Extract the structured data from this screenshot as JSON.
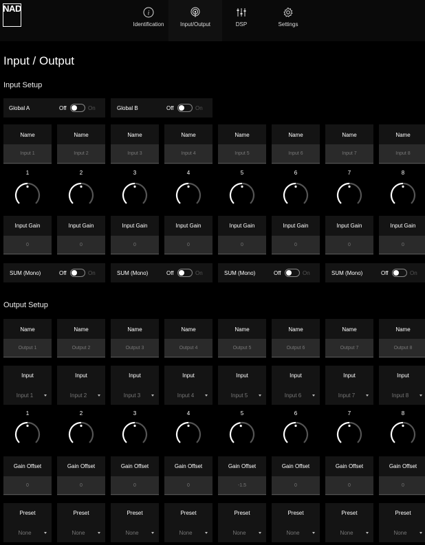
{
  "brand": {
    "logo_text": "NAD"
  },
  "nav": {
    "tabs": [
      {
        "label": "Identification",
        "icon": "info-icon",
        "active": false
      },
      {
        "label": "Input/Output",
        "icon": "broadcast-icon",
        "active": true
      },
      {
        "label": "DSP",
        "icon": "sliders-icon",
        "active": false
      },
      {
        "label": "Settings",
        "icon": "gear-icon",
        "active": false
      }
    ]
  },
  "page_title": "Input / Output",
  "input_setup": {
    "title": "Input Setup",
    "globals": [
      {
        "label": "Global A",
        "off": "Off",
        "on": "On",
        "state": "off"
      },
      {
        "label": "Global B",
        "off": "Off",
        "on": "On",
        "state": "off"
      }
    ],
    "channels": [
      {
        "name_label": "Name",
        "name_placeholder": "Input 1",
        "num": "1",
        "gain_label": "Input Gain",
        "gain": "0",
        "sum_label": "SUM (Mono)",
        "knob_level": 0.0
      },
      {
        "name_label": "Name",
        "name_placeholder": "Input 2",
        "num": "2",
        "gain_label": "Input Gain",
        "gain": "0",
        "sum_label": "SUM (Mono)",
        "knob_level": 0.0
      },
      {
        "name_label": "Name",
        "name_placeholder": "Input 3",
        "num": "3",
        "gain_label": "Input Gain",
        "gain": "0",
        "sum_label": "SUM (Mono)",
        "knob_level": 0.0
      },
      {
        "name_label": "Name",
        "name_placeholder": "Input 4",
        "num": "4",
        "gain_label": "Input Gain",
        "gain": "0",
        "sum_label": "SUM (Mono)",
        "knob_level": 0.0
      },
      {
        "name_label": "Name",
        "name_placeholder": "Input 5",
        "num": "5",
        "gain_label": "Input Gain",
        "gain": "0",
        "sum_label": "SUM (Mono)",
        "knob_level": 0.0
      },
      {
        "name_label": "Name",
        "name_placeholder": "Input 6",
        "num": "6",
        "gain_label": "Input Gain",
        "gain": "0",
        "sum_label": "SUM (Mono)",
        "knob_level": 0.0
      },
      {
        "name_label": "Name",
        "name_placeholder": "Input 7",
        "num": "7",
        "gain_label": "Input Gain",
        "gain": "0",
        "sum_label": "SUM (Mono)",
        "knob_level": 0.0
      },
      {
        "name_label": "Name",
        "name_placeholder": "Input 8",
        "num": "8",
        "gain_label": "Input Gain",
        "gain": "0",
        "sum_label": "SUM (Mono)",
        "knob_level": 0.0
      }
    ],
    "sum_toggle": {
      "off": "Off",
      "on": "On",
      "state": "off"
    }
  },
  "output_setup": {
    "title": "Output Setup",
    "channels": [
      {
        "name_label": "Name",
        "name_placeholder": "Output 1",
        "input_label": "Input",
        "input_value": "Input 1",
        "num": "1",
        "offset_label": "Gain Offset",
        "offset": "0",
        "preset_label": "Preset",
        "preset": "None",
        "knob_level": 0.0
      },
      {
        "name_label": "Name",
        "name_placeholder": "Output 2",
        "input_label": "Input",
        "input_value": "Input 2",
        "num": "2",
        "offset_label": "Gain Offset",
        "offset": "0",
        "preset_label": "Preset",
        "preset": "None",
        "knob_level": 0.0
      },
      {
        "name_label": "Name",
        "name_placeholder": "Output 3",
        "input_label": "Input",
        "input_value": "Input 3",
        "num": "3",
        "offset_label": "Gain Offset",
        "offset": "0",
        "preset_label": "Preset",
        "preset": "None",
        "knob_level": 0.0
      },
      {
        "name_label": "Name",
        "name_placeholder": "Output 4",
        "input_label": "Input",
        "input_value": "Input 4",
        "num": "4",
        "offset_label": "Gain Offset",
        "offset": "0",
        "preset_label": "Preset",
        "preset": "None",
        "knob_level": 0.0
      },
      {
        "name_label": "Name",
        "name_placeholder": "Output 5",
        "input_label": "Input",
        "input_value": "Input 5",
        "num": "5",
        "offset_label": "Gain Offset",
        "offset": "-1.5",
        "preset_label": "Preset",
        "preset": "None",
        "knob_level": -0.06
      },
      {
        "name_label": "Name",
        "name_placeholder": "Output 6",
        "input_label": "Input",
        "input_value": "Input 6",
        "num": "6",
        "offset_label": "Gain Offset",
        "offset": "0",
        "preset_label": "Preset",
        "preset": "None",
        "knob_level": 0.0
      },
      {
        "name_label": "Name",
        "name_placeholder": "Output 7",
        "input_label": "Input",
        "input_value": "Input 7",
        "num": "7",
        "offset_label": "Gain Offset",
        "offset": "0",
        "preset_label": "Preset",
        "preset": "None",
        "knob_level": 0.0
      },
      {
        "name_label": "Name",
        "name_placeholder": "Output 8",
        "input_label": "Input",
        "input_value": "Input 8",
        "num": "8",
        "offset_label": "Gain Offset",
        "offset": "0",
        "preset_label": "Preset",
        "preset": "None",
        "knob_level": 0.0
      }
    ]
  },
  "colors": {
    "background": "#000000",
    "panel": "#141414",
    "field": "#2a2a2a",
    "knob_track": "#555555"
  }
}
